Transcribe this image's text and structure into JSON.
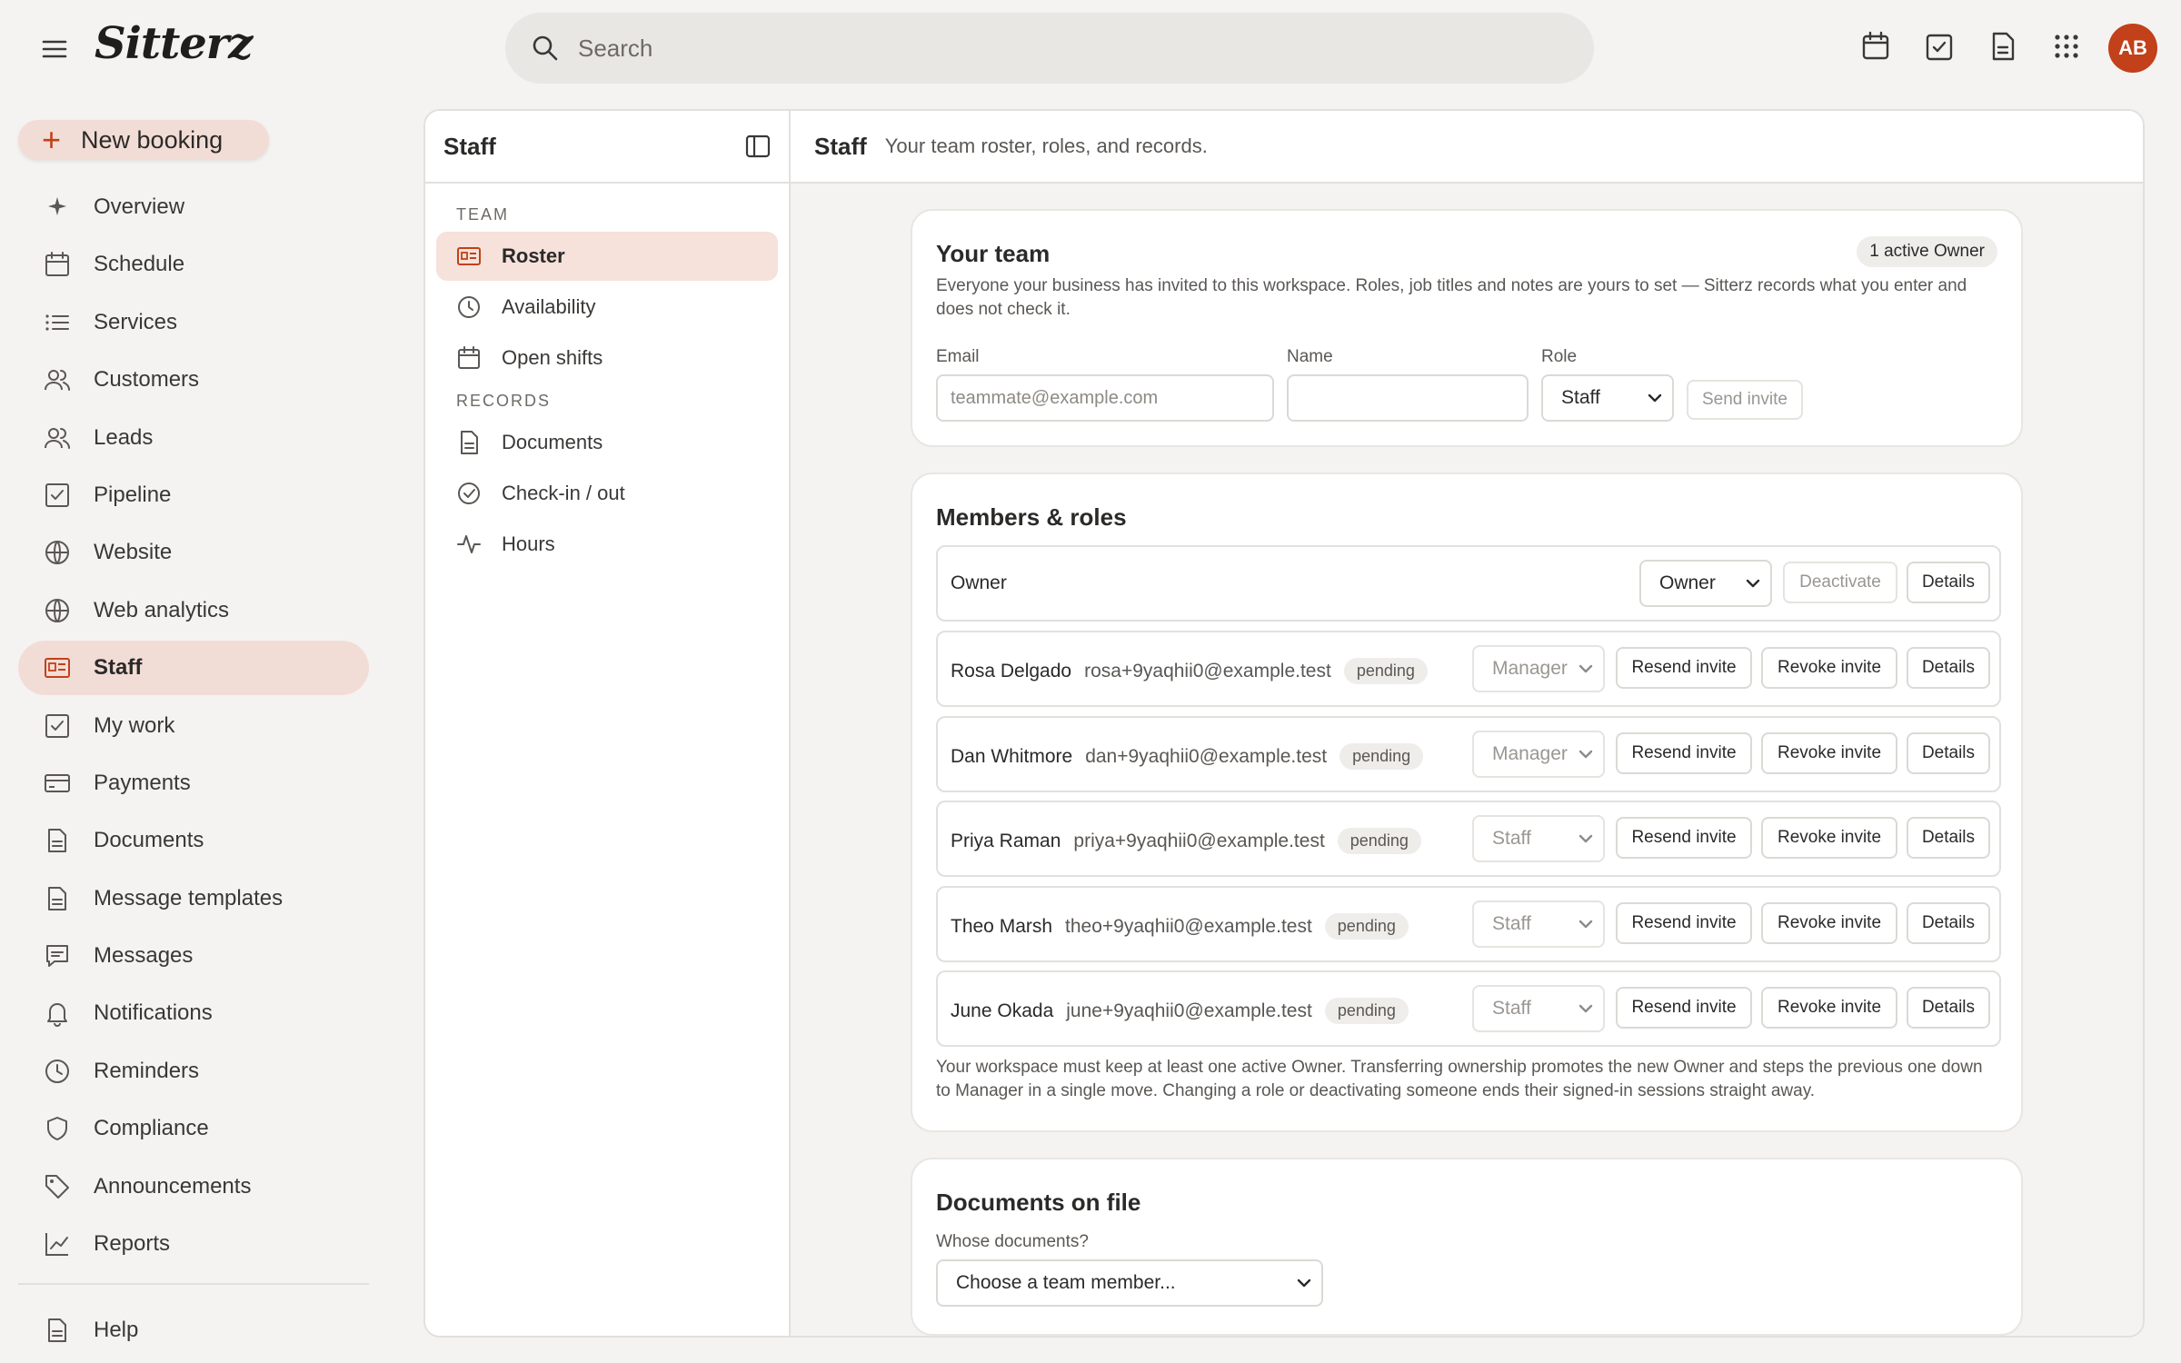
{
  "app": {
    "logo": "Sitterz",
    "avatar_initials": "AB"
  },
  "search": {
    "placeholder": "Search"
  },
  "top_icons": [
    "calendar-icon",
    "checkbox-icon",
    "document-icon",
    "apps-grid-icon"
  ],
  "new_booking": {
    "label": "New booking"
  },
  "nav": {
    "items": [
      {
        "label": "Overview",
        "icon": "sparkle-icon"
      },
      {
        "label": "Schedule",
        "icon": "calendar-icon"
      },
      {
        "label": "Services",
        "icon": "list-icon"
      },
      {
        "label": "Customers",
        "icon": "people-icon"
      },
      {
        "label": "Leads",
        "icon": "people-icon"
      },
      {
        "label": "Pipeline",
        "icon": "checkbox-icon"
      },
      {
        "label": "Website",
        "icon": "globe-icon"
      },
      {
        "label": "Web analytics",
        "icon": "globe-icon"
      },
      {
        "label": "Staff",
        "icon": "id-card-icon",
        "active": true
      },
      {
        "label": "My work",
        "icon": "checkbox-icon"
      },
      {
        "label": "Payments",
        "icon": "card-icon"
      },
      {
        "label": "Documents",
        "icon": "document-icon"
      },
      {
        "label": "Message templates",
        "icon": "document-icon"
      },
      {
        "label": "Messages",
        "icon": "chat-icon"
      },
      {
        "label": "Notifications",
        "icon": "bell-icon"
      },
      {
        "label": "Reminders",
        "icon": "clock-icon"
      },
      {
        "label": "Compliance",
        "icon": "shield-icon"
      },
      {
        "label": "Announcements",
        "icon": "tag-icon"
      },
      {
        "label": "Reports",
        "icon": "chart-icon"
      }
    ],
    "help": "Help"
  },
  "subnav": {
    "title": "Staff",
    "team_label": "TEAM",
    "team_items": [
      {
        "label": "Roster",
        "active": true
      },
      {
        "label": "Availability"
      },
      {
        "label": "Open shifts"
      }
    ],
    "records_label": "RECORDS",
    "records_items": [
      {
        "label": "Documents"
      },
      {
        "label": "Check-in / out"
      },
      {
        "label": "Hours"
      }
    ]
  },
  "header": {
    "title": "Staff",
    "subtitle": "Your team roster, roles, and records."
  },
  "your_team": {
    "title": "Your team",
    "badge": "1 active Owner",
    "description": "Everyone your business has invited to this workspace. Roles, job titles and notes are yours to set — Sitterz records what you enter and does not check it.",
    "email_label": "Email",
    "email_placeholder": "teammate@example.com",
    "name_label": "Name",
    "name_value": "",
    "role_label": "Role",
    "role_value": "Staff",
    "send_invite": "Send invite"
  },
  "members": {
    "title": "Members & roles",
    "owner": {
      "name": "Owner",
      "role": "Owner",
      "deactivate": "Deactivate",
      "details": "Details"
    },
    "rows": [
      {
        "name": "Rosa Delgado",
        "email": "rosa+9yaqhii0@example.test",
        "status": "pending",
        "role": "Manager",
        "resend": "Resend invite",
        "revoke": "Revoke invite",
        "details": "Details"
      },
      {
        "name": "Dan Whitmore",
        "email": "dan+9yaqhii0@example.test",
        "status": "pending",
        "role": "Manager",
        "resend": "Resend invite",
        "revoke": "Revoke invite",
        "details": "Details"
      },
      {
        "name": "Priya Raman",
        "email": "priya+9yaqhii0@example.test",
        "status": "pending",
        "role": "Staff",
        "resend": "Resend invite",
        "revoke": "Revoke invite",
        "details": "Details"
      },
      {
        "name": "Theo Marsh",
        "email": "theo+9yaqhii0@example.test",
        "status": "pending",
        "role": "Staff",
        "resend": "Resend invite",
        "revoke": "Revoke invite",
        "details": "Details"
      },
      {
        "name": "June Okada",
        "email": "june+9yaqhii0@example.test",
        "status": "pending",
        "role": "Staff",
        "resend": "Resend invite",
        "revoke": "Revoke invite",
        "details": "Details"
      }
    ],
    "footnote": "Your workspace must keep at least one active Owner. Transferring ownership promotes the new Owner and steps the previous one down to Manager in a single move. Changing a role or deactivating someone ends their signed-in sessions straight away."
  },
  "documents": {
    "title": "Documents on file",
    "whose_label": "Whose documents?",
    "select_value": "Choose a team member..."
  },
  "colors": {
    "accent": "#c2401a",
    "active_bg": "#f2ddd6",
    "page_bg": "#f4f3f2"
  }
}
